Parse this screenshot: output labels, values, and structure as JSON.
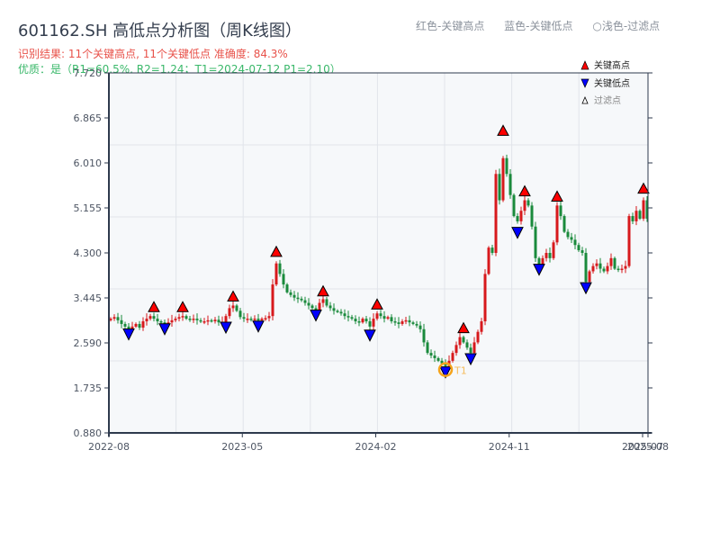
{
  "title": "601162.SH 高低点分析图（周K线图）",
  "result_line": "识别结果: 11个关键高点, 11个关键低点   准确度: 84.3%",
  "quality_line": "优质：是（R1=60.5%, R2=1.24；T1=2024-07-12 P1=2.10）",
  "top_legend": [
    "红色-关键高点",
    "蓝色-关键低点",
    "○浅色-过滤点"
  ],
  "colors": {
    "up": "#d7191c",
    "down": "#1a8a3c",
    "high_marker": "#ff0000",
    "low_marker": "#0000ff",
    "t1_ring": "#f5a31a",
    "axis": "#2e3a4d",
    "grid": "#e1e4ea",
    "plot_bg": "#f6f8fa"
  },
  "chart_data": {
    "type": "candlestick",
    "ylim": [
      0.88,
      7.72
    ],
    "yticks": [
      "0.880",
      "1.735",
      "2.590",
      "3.445",
      "4.300",
      "5.155",
      "6.010",
      "6.865",
      "7.720"
    ],
    "xticks": [
      {
        "label": "2022-08",
        "index": 0
      },
      {
        "label": "2023-05",
        "index": 37
      },
      {
        "label": "2024-02",
        "index": 74
      },
      {
        "label": "2024-11",
        "index": 111
      },
      {
        "label": "2025-07",
        "index": 148
      },
      {
        "label": "2025-08",
        "index": 149.5
      }
    ],
    "grid": true,
    "close": [
      3.05,
      3.08,
      3.02,
      2.95,
      2.9,
      2.85,
      2.9,
      2.95,
      2.88,
      3.0,
      3.05,
      3.1,
      3.05,
      3.0,
      2.98,
      2.95,
      2.98,
      3.02,
      3.05,
      3.08,
      3.1,
      3.05,
      3.03,
      3.05,
      3.02,
      3.0,
      3.0,
      3.02,
      3.0,
      3.03,
      2.98,
      2.99,
      3.1,
      3.25,
      3.3,
      3.2,
      3.08,
      3.05,
      3.05,
      3.03,
      3.05,
      3.02,
      3.05,
      3.06,
      3.1,
      3.7,
      4.1,
      3.9,
      3.7,
      3.55,
      3.5,
      3.45,
      3.43,
      3.4,
      3.35,
      3.3,
      3.25,
      3.22,
      3.35,
      3.42,
      3.3,
      3.25,
      3.2,
      3.18,
      3.15,
      3.1,
      3.08,
      3.05,
      3.0,
      2.98,
      3.05,
      3.0,
      2.9,
      3.05,
      3.15,
      3.1,
      3.05,
      3.08,
      3.0,
      2.98,
      2.95,
      3.0,
      3.02,
      2.98,
      2.95,
      2.92,
      2.85,
      2.6,
      2.4,
      2.35,
      2.3,
      2.25,
      2.2,
      2.15,
      2.25,
      2.4,
      2.55,
      2.7,
      2.6,
      2.5,
      2.4,
      2.6,
      2.8,
      3.0,
      3.9,
      4.4,
      4.3,
      5.8,
      5.3,
      6.1,
      5.8,
      5.4,
      5.0,
      4.9,
      5.1,
      5.3,
      5.2,
      4.8,
      4.2,
      4.05,
      4.2,
      4.3,
      4.2,
      4.5,
      5.2,
      5.0,
      4.7,
      4.6,
      4.55,
      4.45,
      4.35,
      4.3,
      3.75,
      3.95,
      4.05,
      4.1,
      4.0,
      3.95,
      4.05,
      4.2,
      4.0,
      3.98,
      4.0,
      4.05,
      5.0,
      4.9,
      5.1,
      4.95,
      5.3,
      4.95
    ],
    "key_highs": [
      {
        "index": 12,
        "price": 3.15
      },
      {
        "index": 20,
        "price": 3.15
      },
      {
        "index": 34,
        "price": 3.35
      },
      {
        "index": 46,
        "price": 4.2
      },
      {
        "index": 59,
        "price": 3.45
      },
      {
        "index": 74,
        "price": 3.2
      },
      {
        "index": 98,
        "price": 2.75
      },
      {
        "index": 109,
        "price": 6.5
      },
      {
        "index": 115,
        "price": 5.35
      },
      {
        "index": 124,
        "price": 5.25
      },
      {
        "index": 148,
        "price": 5.4
      }
    ],
    "key_lows": [
      {
        "index": 5,
        "price": 2.82
      },
      {
        "index": 15,
        "price": 2.92
      },
      {
        "index": 32,
        "price": 2.95
      },
      {
        "index": 41,
        "price": 2.97
      },
      {
        "index": 57,
        "price": 3.18
      },
      {
        "index": 72,
        "price": 2.8
      },
      {
        "index": 93,
        "price": 2.1
      },
      {
        "index": 100,
        "price": 2.35
      },
      {
        "index": 113,
        "price": 4.75
      },
      {
        "index": 119,
        "price": 4.05
      },
      {
        "index": 132,
        "price": 3.7
      }
    ],
    "t1": {
      "label": "T1",
      "index": 93,
      "price": 2.1
    },
    "legend": {
      "position": "top-right",
      "items": [
        "关键高点",
        "关键低点",
        "过滤点"
      ]
    }
  }
}
